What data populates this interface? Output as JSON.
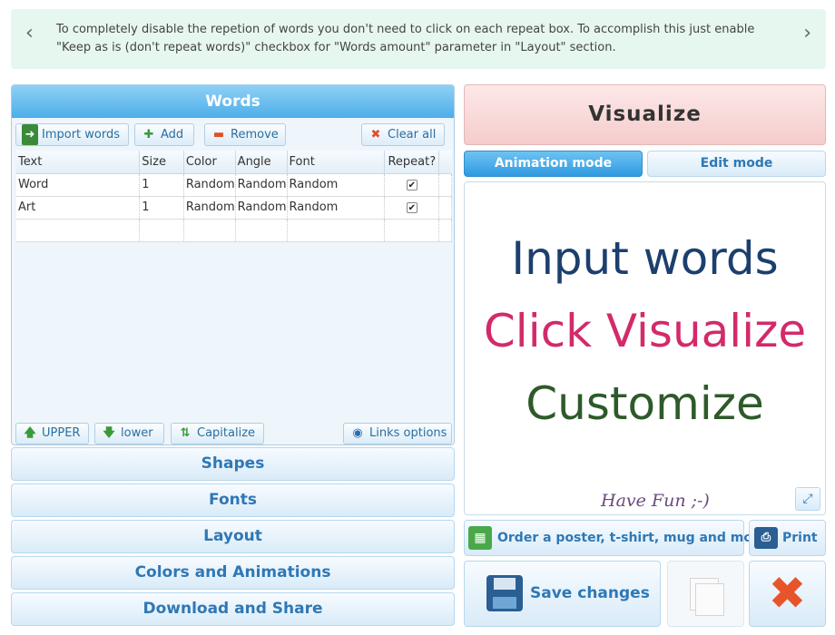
{
  "tip": {
    "text": "To completely disable the repetion of words you don't need to click on each repeat box. To accomplish this just enable \"Keep as is (don't repeat words)\" checkbox for \"Words amount\" parameter in \"Layout\" section."
  },
  "words_panel": {
    "title": "Words",
    "toolbar": {
      "import": "Import words",
      "add": "Add",
      "remove": "Remove",
      "clear": "Clear all"
    },
    "columns": [
      "Text",
      "Size",
      "Color",
      "Angle",
      "Font",
      "Repeat?"
    ],
    "rows": [
      {
        "text": "Word",
        "size": "1",
        "color": "Random",
        "angle": "Random",
        "font": "Random",
        "repeat": true
      },
      {
        "text": "Art",
        "size": "1",
        "color": "Random",
        "angle": "Random",
        "font": "Random",
        "repeat": true
      }
    ],
    "case_buttons": {
      "upper": "UPPER",
      "lower": "lower",
      "capitalize": "Capitalize",
      "links": "Links options"
    }
  },
  "sections": [
    "Shapes",
    "Fonts",
    "Layout",
    "Colors and Animations",
    "Download and Share"
  ],
  "right": {
    "visualize": "Visualize",
    "modes": {
      "animation": "Animation mode",
      "edit": "Edit mode"
    },
    "canvas": {
      "line1": "Input words",
      "line2": "Click Visualize",
      "line3": "Customize",
      "fun": "Have Fun ;-)"
    },
    "order": "Order a poster, t-shirt, mug and more!",
    "print": "Print",
    "save": "Save changes"
  },
  "colors": {
    "header_blue": "#4daee9",
    "link_blue": "#2f78b5",
    "line1": "#1c3f6e",
    "line2": "#d22a6a",
    "line3": "#2e5a2a"
  }
}
